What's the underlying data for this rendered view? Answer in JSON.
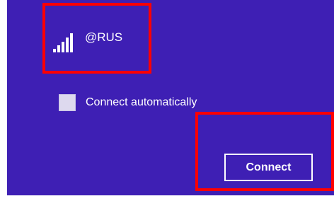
{
  "network": {
    "name": "@RUS",
    "signal_icon": "wifi-signal-icon"
  },
  "options": {
    "connect_automatically_label": "Connect automatically",
    "connect_automatically_checked": false
  },
  "actions": {
    "connect_label": "Connect"
  },
  "colors": {
    "panel_background": "#3e1fb4",
    "checkbox_fill": "#ddd9ee",
    "highlight": "#ff0000",
    "text": "#ffffff"
  }
}
